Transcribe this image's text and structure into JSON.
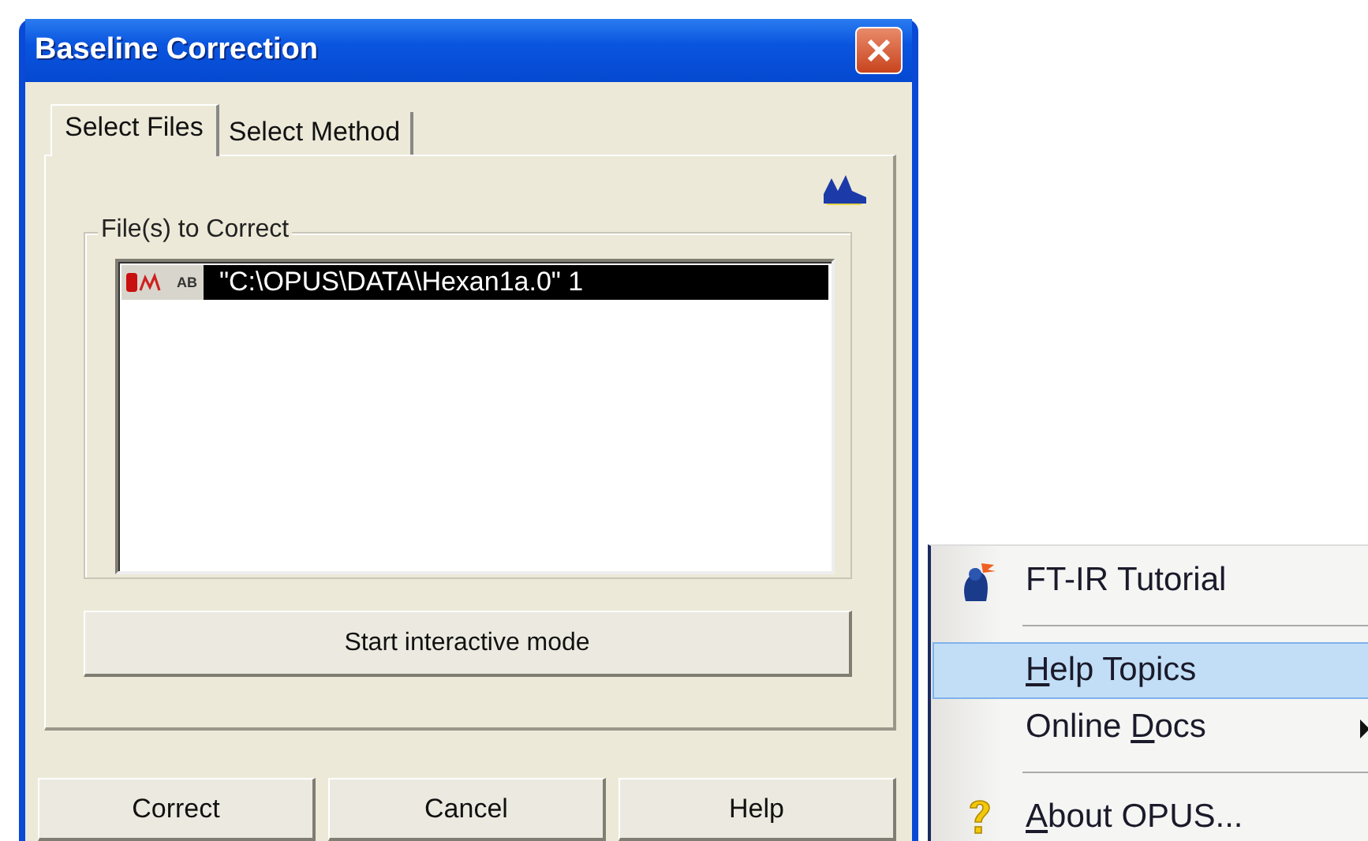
{
  "dialog": {
    "title": "Baseline Correction",
    "tabs": [
      {
        "label": "Select Files",
        "selected": true
      },
      {
        "label": "Select Method",
        "selected": false
      }
    ],
    "group": {
      "label": "File(s) to Correct",
      "files": [
        {
          "badge": "AB",
          "path": "\"C:\\OPUS\\DATA\\Hexan1a.0\" 1",
          "selected": true
        }
      ]
    },
    "interactive_button": "Start interactive mode",
    "buttons": [
      "Correct",
      "Cancel",
      "Help"
    ]
  },
  "menu": {
    "items": [
      {
        "kind": "item",
        "before": "FT-IR Tutorial",
        "selected": false
      },
      {
        "kind": "separator"
      },
      {
        "kind": "item",
        "key": "H",
        "after": "elp Topics",
        "selected": true
      },
      {
        "kind": "item",
        "before": "Online ",
        "key": "D",
        "after": "ocs",
        "selected": false,
        "submenu": true
      },
      {
        "kind": "separator"
      },
      {
        "kind": "item",
        "key": "A",
        "after": "bout OPUS...",
        "selected": false
      }
    ]
  }
}
